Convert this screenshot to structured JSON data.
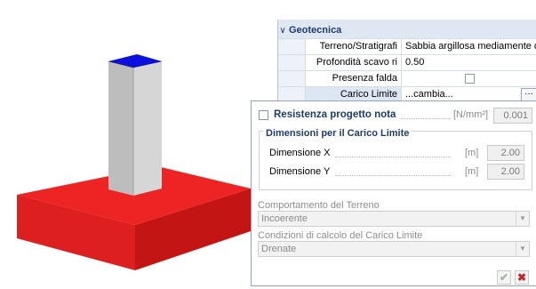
{
  "property_grid": {
    "group_title": "Geotecnica",
    "rows": [
      {
        "name": "Terreno/Stratigrafi",
        "value": "Sabbia argillosa mediamente consc"
      },
      {
        "name": "Profondità scavo ri",
        "value": "0.50"
      },
      {
        "name": "Presenza falda",
        "value": ""
      },
      {
        "name": "Carico Limite",
        "value": "...cambia...",
        "button": "···"
      }
    ]
  },
  "panel": {
    "resistenza": {
      "label": "Resistenza progetto nota",
      "unit": "[N/mm²]",
      "value": "0.001"
    },
    "dimensioni": {
      "title": "Dimensioni per il Carico Limite",
      "x": {
        "label": "Dimensione X",
        "unit": "[m]",
        "value": "2.00"
      },
      "y": {
        "label": "Dimensione Y",
        "unit": "[m]",
        "value": "2.00"
      }
    },
    "comportamento": {
      "label": "Comportamento del Terreno",
      "value": "Incoerente"
    },
    "condizioni": {
      "label": "Condizioni di calcolo del Carico Limite",
      "value": "Drenate"
    },
    "ok_icon": "checkmark-icon",
    "cancel_icon": "close-icon"
  },
  "colors": {
    "footing_front": "#dd1f1f",
    "footing_side": "#c41515",
    "footing_top": "#ee2424",
    "column_front": "#bdbdbd",
    "column_side": "#d6d6d6",
    "column_top": "#0a10e0"
  }
}
